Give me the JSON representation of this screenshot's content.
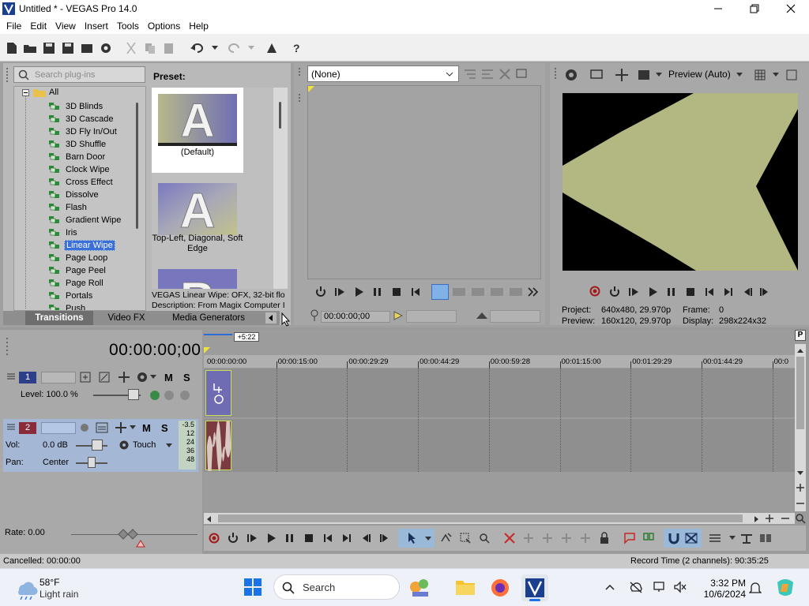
{
  "window": {
    "title": "Untitled * - VEGAS Pro 14.0",
    "controls": [
      "minimize-icon",
      "maximize-icon",
      "close-icon"
    ]
  },
  "menu": [
    "File",
    "Edit",
    "View",
    "Insert",
    "Tools",
    "Options",
    "Help"
  ],
  "plugin_chooser": {
    "search_placeholder": "Search plug-ins",
    "root": "All",
    "items": [
      "3D Blinds",
      "3D Cascade",
      "3D Fly In/Out",
      "3D Shuffle",
      "Barn Door",
      "Clock Wipe",
      "Cross Effect",
      "Dissolve",
      "Flash",
      "Gradient Wipe",
      "Iris",
      "Linear Wipe",
      "Page Loop",
      "Page Peel",
      "Page Roll",
      "Portals",
      "Push"
    ],
    "selected": "Linear Wipe",
    "preset_label": "Preset:",
    "presets": [
      "(Default)",
      "Top-Left, Diagonal, Soft Edge"
    ],
    "description_line1": "VEGAS Linear Wipe: OFX, 32-bit flo",
    "description_line2": "Description: From Magix Computer I",
    "tabs": [
      "Transitions",
      "Video FX",
      "Media Generators"
    ],
    "active_tab": "Transitions"
  },
  "trimmer": {
    "select_value": "(None)",
    "timecode": "00:00:00;00"
  },
  "preview": {
    "mode": "Preview (Auto)",
    "project_label": "Project:",
    "project_value": "640x480, 29.970p",
    "preview_label": "Preview:",
    "preview_value": "160x120, 29.970p",
    "frame_label": "Frame:",
    "frame_value": "0",
    "display_label": "Display:",
    "display_value": "298x224x32",
    "bg_color": "#000000",
    "shape_color": "#b3b883"
  },
  "timeline": {
    "timecode": "00:00:00;00",
    "offset_badge": "+5:22",
    "ruler": [
      "00:00:00:00",
      "00:00:15:00",
      "00:00:29:29",
      "00:00:44:29",
      "00:00:59:28",
      "00:01:15:00",
      "00:01:29:29",
      "00:01:44:29",
      "00:0"
    ],
    "track1": {
      "number": "1",
      "level_label": "Level: 100.0 %",
      "m": "M",
      "s": "S",
      "color": "#2e3f8a"
    },
    "track2": {
      "number": "2",
      "vol_label": "Vol:",
      "vol_value": "0.0 dB",
      "pan_label": "Pan:",
      "pan_value": "Center",
      "automation": "Touch",
      "m": "M",
      "s": "S",
      "meter": [
        "-3.5",
        "12",
        "24",
        "36",
        "48"
      ],
      "color": "#8a2b3a"
    },
    "rate": "Rate: 0.00"
  },
  "status": {
    "left": "Cancelled: 00:00:00",
    "right": "Record Time (2 channels): 90:35:25"
  },
  "taskbar": {
    "weather_temp": "58°F",
    "weather_desc": "Light rain",
    "search_label": "Search",
    "time": "3:32 PM",
    "date": "10/6/2024"
  }
}
